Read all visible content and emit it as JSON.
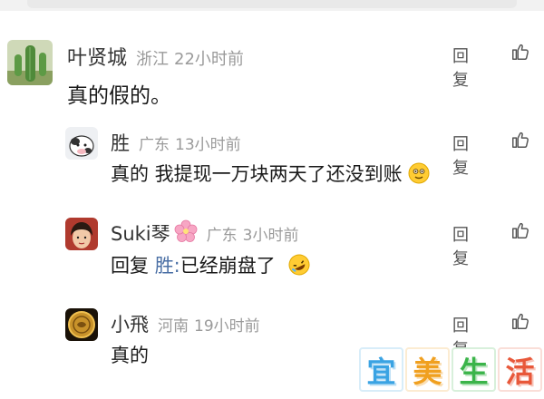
{
  "comments": [
    {
      "username": "叶贤城",
      "location": "浙江",
      "time": "22小时前",
      "text": "真的假的。",
      "reply_label": "回复"
    },
    {
      "username": "胜",
      "location": "广东",
      "time": "13小时前",
      "text": "真的 我提现一万块两天了还没到账",
      "reply_label": "回复"
    },
    {
      "username": "Suki琴",
      "location": "广东",
      "time": "3小时前",
      "text_prefix": "回复",
      "mention": "胜:",
      "text": "已经崩盘了",
      "reply_label": "回复"
    },
    {
      "username": "小飛",
      "location": "河南",
      "time": "19小时前",
      "text": "真的",
      "reply_label": "回复"
    }
  ],
  "watermark": {
    "chars": [
      "宜",
      "美",
      "生",
      "活"
    ],
    "colors": [
      "#3aa3e3",
      "#f0a020",
      "#3bb44a",
      "#e8583a"
    ]
  },
  "icons": {
    "like": "thumbs-up-icon",
    "emoji_smile": "smiling-face-emoji-icon",
    "emoji_laugh": "rolling-laughing-emoji-icon",
    "flower": "cherry-blossom-icon"
  }
}
